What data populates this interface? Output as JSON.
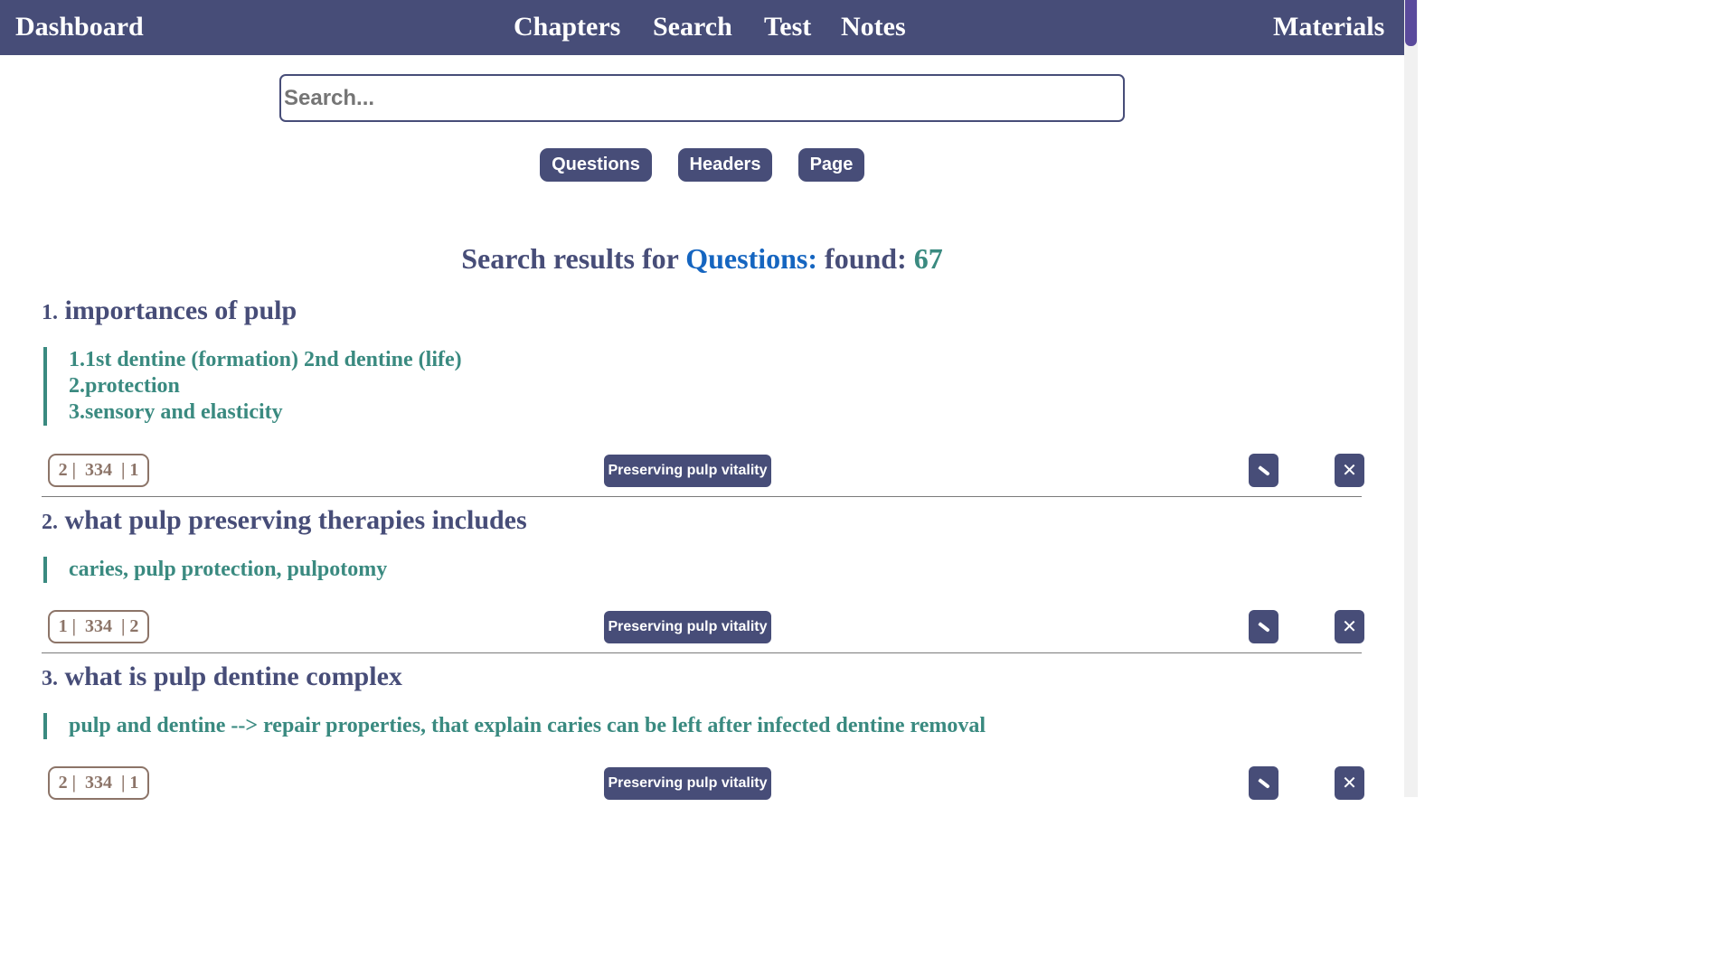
{
  "nav": {
    "dashboard": "Dashboard",
    "chapters": "Chapters",
    "search": "Search",
    "test": "Test",
    "notes": "Notes",
    "materials": "Materials"
  },
  "search": {
    "placeholder": "Search..."
  },
  "filters": {
    "questions": "Questions",
    "headers": "Headers",
    "page": "Page"
  },
  "results": {
    "prefix": "Search results for",
    "type": "Questions:",
    "found_label": "found:",
    "count": "67"
  },
  "questions": [
    {
      "number": "1.",
      "title": "importances of pulp",
      "answer_lines": [
        "1.1st dentine (formation) 2nd dentine (life)",
        "2.protection",
        "3.sensory and elasticity"
      ],
      "meta": "2 |  334  | 1",
      "tag": "Preserving pulp vitality"
    },
    {
      "number": "2.",
      "title": "what pulp preserving therapies includes",
      "answer_lines": [
        "caries, pulp protection, pulpotomy"
      ],
      "meta": "1 |  334  | 2",
      "tag": "Preserving pulp vitality"
    },
    {
      "number": "3.",
      "title": "what is pulp dentine complex",
      "answer_lines": [
        "pulp and dentine --> repair properties, that explain caries can be left after infected dentine removal"
      ],
      "meta": "2 |  334  | 1",
      "tag": "Preserving pulp vitality"
    }
  ],
  "icons": {
    "edit": "pencil-icon",
    "delete": "close-icon"
  },
  "colors": {
    "primary": "#474d78",
    "answer": "#3a8a80",
    "results_type": "#1565c0",
    "meta": "#8c7468"
  }
}
